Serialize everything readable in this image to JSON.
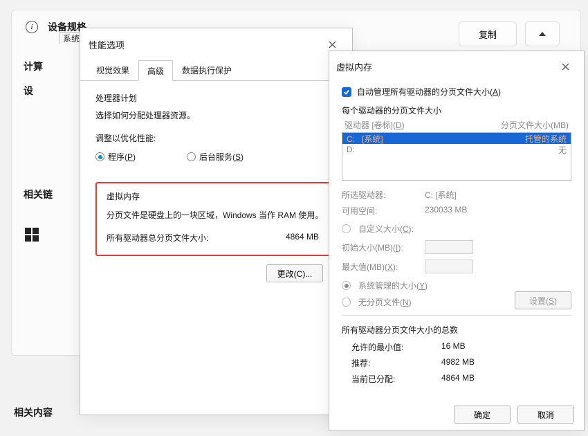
{
  "settings": {
    "title": "设备规格",
    "copy": "复制",
    "rows": {
      "compute": "计算",
      "device": "设"
    },
    "related_links": "相关链",
    "related_content": "相关内容"
  },
  "sysprop": {
    "title": "系统"
  },
  "perf": {
    "title": "性能选项",
    "tabs": {
      "visual": "视觉效果",
      "advanced": "高级",
      "dep": "数据执行保护"
    },
    "sched": {
      "title": "处理器计划",
      "desc": "选择如何分配处理器资源。",
      "adjust": "调整以优化性能:"
    },
    "radio_programs_pre": "程序(",
    "radio_programs_key": "P",
    "radio_close": ")",
    "radio_bg_pre": "后台服务(",
    "radio_bg_key": "S",
    "vm": {
      "title": "虚拟内存",
      "desc": "分页文件是硬盘上的一块区域，Windows 当作 RAM 使用。",
      "total_label": "所有驱动器总分页文件大小:",
      "total_value": "4864 MB",
      "change": "更改(C)..."
    }
  },
  "vmd": {
    "title": "虚拟内存",
    "auto_pre": "自动管理所有驱动器的分页文件大小(",
    "auto_key": "A",
    "per_drive": "每个驱动器的分页文件大小",
    "col_drive_pre": "驱动器 [卷标](",
    "col_drive_key": "D",
    "col_size": "分页文件大小(MB)",
    "driveC_label": "C:",
    "driveC_vol": "[系统]",
    "driveC_val": "托管的系统",
    "driveD_label": "D:",
    "driveD_val": "无",
    "selected_drive_label": "所选驱动器:",
    "selected_drive_value": "C: [系统]",
    "free_label": "可用空间:",
    "free_value": "230033 MB",
    "custom_pre": "自定义大小(",
    "custom_key": "C",
    "custom_suf": "):",
    "init_pre": "初始大小(MB)(",
    "init_key": "I",
    "max_pre": "最大值(MB)(",
    "max_key": "X",
    "sys_pre": "系统管理的大小(",
    "sys_key": "Y",
    "none_pre": "无分页文件(",
    "none_key": "N",
    "set_pre": "设置(",
    "set_key": "S",
    "summary_title": "所有驱动器分页文件大小的总数",
    "min_label": "允许的最小值:",
    "min_value": "16 MB",
    "rec_label": "推荐:",
    "rec_value": "4982 MB",
    "cur_label": "当前已分配:",
    "cur_value": "4864 MB",
    "ok": "确定",
    "cancel": "取消"
  }
}
